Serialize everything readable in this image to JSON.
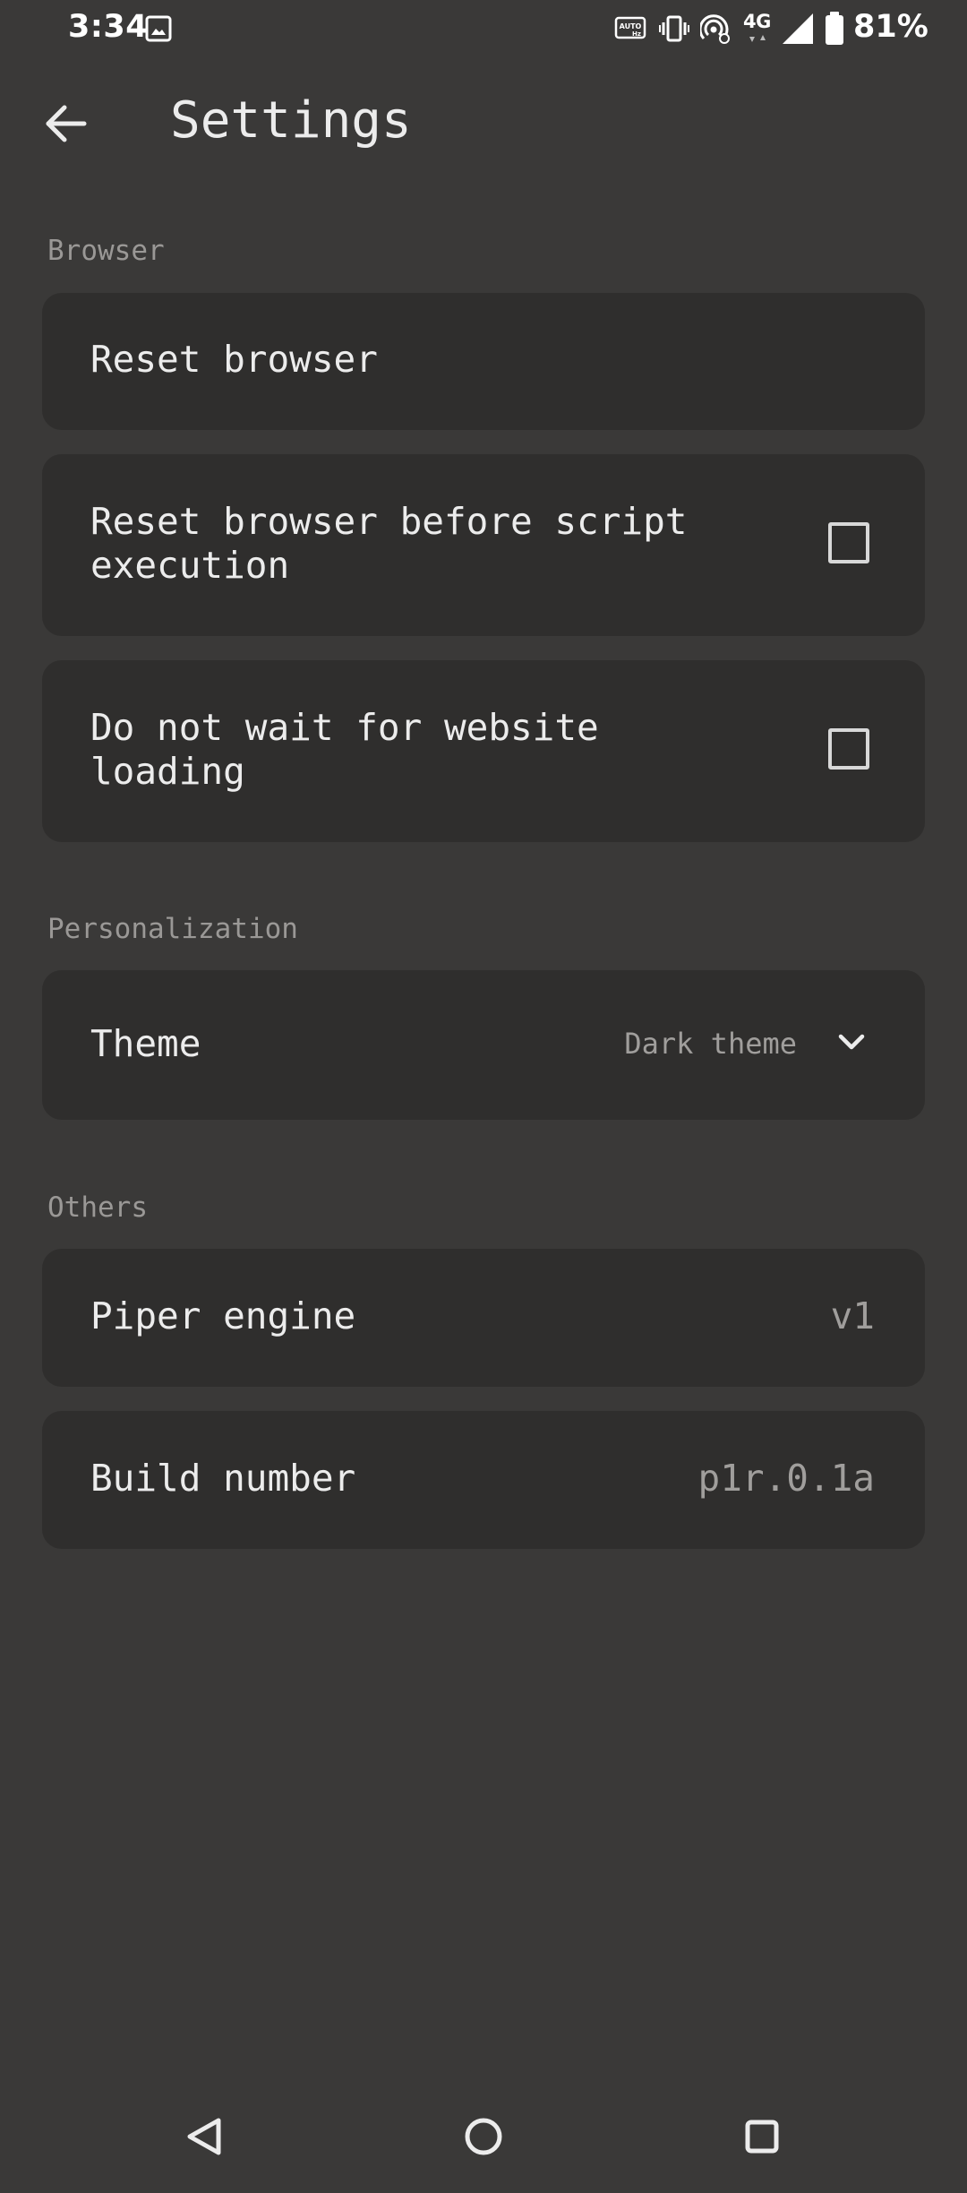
{
  "status_bar": {
    "time": "3:34",
    "network": "4G",
    "battery": "81%",
    "icons": [
      "gallery-icon",
      "auto-hz-icon",
      "vibrate-icon",
      "hotspot-icon",
      "signal-icon",
      "battery-icon"
    ]
  },
  "app_bar": {
    "title": "Settings",
    "back_icon": "arrow-left-icon"
  },
  "sections": {
    "browser": {
      "header": "Browser",
      "reset_browser": {
        "label": "Reset browser"
      },
      "reset_before_script": {
        "label": "Reset browser before script execution",
        "checked": false
      },
      "no_wait_loading": {
        "label": "Do not wait for website loading",
        "checked": false
      }
    },
    "personalization": {
      "header": "Personalization",
      "theme": {
        "label": "Theme",
        "value": "Dark theme",
        "icon": "chevron-down-icon"
      }
    },
    "others": {
      "header": "Others",
      "piper_engine": {
        "label": "Piper engine",
        "value": "v1"
      },
      "build_number": {
        "label": "Build number",
        "value": "p1r.0.1a"
      }
    }
  },
  "nav_bar": {
    "icons": [
      "back-triangle-icon",
      "home-circle-icon",
      "recents-square-icon"
    ]
  },
  "colors": {
    "background": "#3a3938",
    "card": "#2f2e2d",
    "text": "#ececec",
    "muted_text": "#9a9896"
  }
}
